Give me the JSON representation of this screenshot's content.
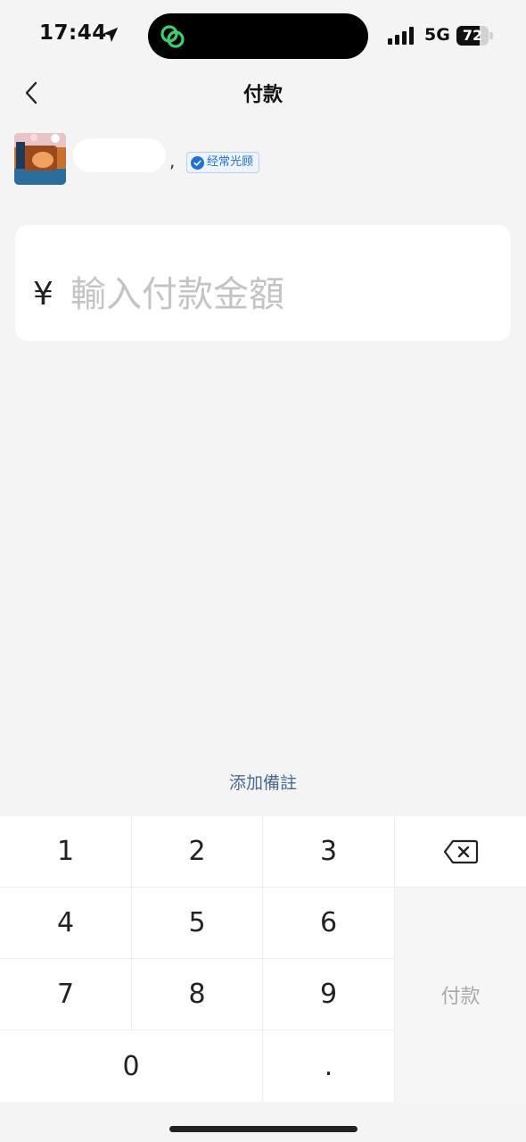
{
  "status_bar": {
    "time": "17:44",
    "network": "5G",
    "battery_level": "72",
    "battery_fraction": 0.72,
    "icons": [
      "location-arrow-icon",
      "chat-app-icon",
      "signal-bars-icon",
      "battery-icon"
    ]
  },
  "nav": {
    "title": "付款",
    "back_icon": "chevron-left-icon"
  },
  "merchant": {
    "separator": ",",
    "badge_label": "经常光顾",
    "badge_icon": "check-circle-icon"
  },
  "amount": {
    "currency_symbol": "¥",
    "placeholder": "輸入付款金額",
    "value": ""
  },
  "add_note_label": "添加備註",
  "keypad": {
    "keys": [
      "1",
      "2",
      "3",
      "4",
      "5",
      "6",
      "7",
      "8",
      "9",
      "0",
      "."
    ],
    "delete_icon": "backspace-icon",
    "pay_label": "付款"
  },
  "colors": {
    "background": "#f4f4f4",
    "accent_blue": "#1f6fd8",
    "link_color": "#4b6a8f",
    "pay_disabled": "#a9a9a9"
  }
}
